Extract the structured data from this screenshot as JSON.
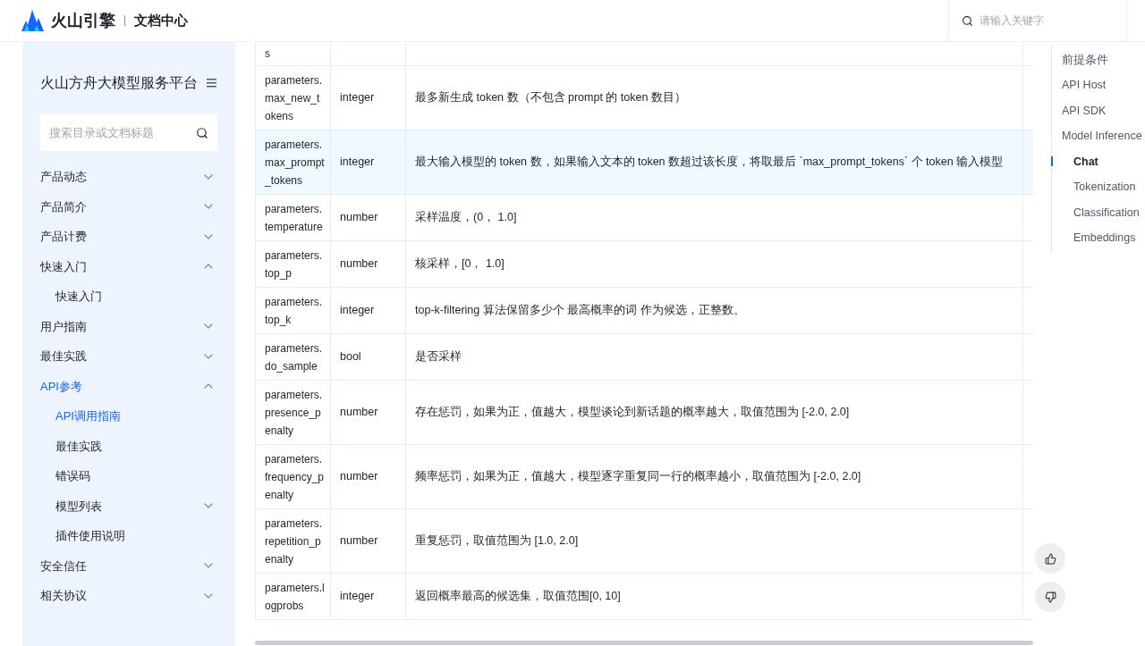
{
  "header": {
    "brand": "火山引擎",
    "section": "文档中心",
    "search": {
      "placeholder": "请输入关键字"
    }
  },
  "sidebar": {
    "title": "火山方舟大模型服务平台",
    "search": {
      "placeholder": "搜索目录或文档标题"
    },
    "items": [
      {
        "label": "产品动态",
        "expanded": false,
        "selected": false
      },
      {
        "label": "产品简介",
        "expanded": false,
        "selected": false
      },
      {
        "label": "产品计费",
        "expanded": false,
        "selected": false
      },
      {
        "label": "快速入门",
        "expanded": true,
        "selected": false,
        "children": [
          {
            "label": "快速入门",
            "selected": false,
            "expandable": false
          }
        ]
      },
      {
        "label": "用户指南",
        "expanded": false,
        "selected": false
      },
      {
        "label": "最佳实践",
        "expanded": false,
        "selected": false
      },
      {
        "label": "API参考",
        "expanded": true,
        "selected": true,
        "children": [
          {
            "label": "API调用指南",
            "selected": true,
            "expandable": false
          },
          {
            "label": "最佳实践",
            "selected": false,
            "expandable": false
          },
          {
            "label": "错误码",
            "selected": false,
            "expandable": false
          },
          {
            "label": "模型列表",
            "selected": false,
            "expandable": true
          },
          {
            "label": "插件使用说明",
            "selected": false,
            "expandable": false
          }
        ]
      },
      {
        "label": "安全信任",
        "expanded": false,
        "selected": false
      },
      {
        "label": "相关协议",
        "expanded": false,
        "selected": false
      }
    ]
  },
  "table": {
    "rows": [
      {
        "name": "s",
        "type": "",
        "description": "",
        "selected": false,
        "kind": "partial"
      },
      {
        "name": "parameters.max_new_tokens",
        "type": "integer",
        "description": "最多新生成 token 数（不包含 prompt 的 token 数目）",
        "selected": false,
        "kind": "full"
      },
      {
        "name": "parameters.max_prompt_tokens",
        "type": "integer",
        "description": "最大输入模型的 token 数，如果输入文本的 token 数超过该长度，将取最后 `max_prompt_tokens` 个 token 输入模型",
        "selected": true,
        "kind": "full"
      },
      {
        "name": "parameters.temperature",
        "type": "number",
        "description": "采样温度，(0， 1.0]",
        "selected": false,
        "kind": "full"
      },
      {
        "name": "parameters.top_p",
        "type": "number",
        "description": "核采样，[0， 1.0]",
        "selected": false,
        "kind": "full"
      },
      {
        "name": "parameters.top_k",
        "type": "integer",
        "description": "top-k-filtering 算法保留多少个 最高概率的词 作为候选，正整数。",
        "selected": false,
        "kind": "full"
      },
      {
        "name": "parameters.do_sample",
        "type": "bool",
        "description": "是否采样",
        "selected": false,
        "kind": "full"
      },
      {
        "name": "parameters.presence_penalty",
        "type": "number",
        "description": "存在惩罚，如果为正，值越大，模型谈论到新话题的概率越大，取值范围为 [-2.0, 2.0]",
        "selected": false,
        "kind": "full"
      },
      {
        "name": "parameters.frequency_penalty",
        "type": "number",
        "description": "频率惩罚，如果为正，值越大，模型逐字重复同一行的概率越小，取值范围为 [-2.0, 2.0]",
        "selected": false,
        "kind": "full"
      },
      {
        "name": "parameters.repetition_penalty",
        "type": "number",
        "description": "重复惩罚，取值范围为 [1.0, 2.0]",
        "selected": false,
        "kind": "full"
      },
      {
        "name": "parameters.logprobs",
        "type": "integer",
        "description": "返回概率最高的候选集，取值范围[0, 10]",
        "selected": false,
        "kind": "full"
      }
    ]
  },
  "toc": {
    "items": [
      {
        "label": "前提条件",
        "selected": false
      },
      {
        "label": "API Host",
        "selected": false
      },
      {
        "label": "API SDK",
        "selected": false
      },
      {
        "label": "Model Inference",
        "selected": false,
        "children": [
          {
            "label": "Chat",
            "selected": true
          },
          {
            "label": "Tokenization",
            "selected": false
          },
          {
            "label": "Classification",
            "selected": false
          },
          {
            "label": "Embeddings",
            "selected": false
          }
        ]
      }
    ]
  }
}
